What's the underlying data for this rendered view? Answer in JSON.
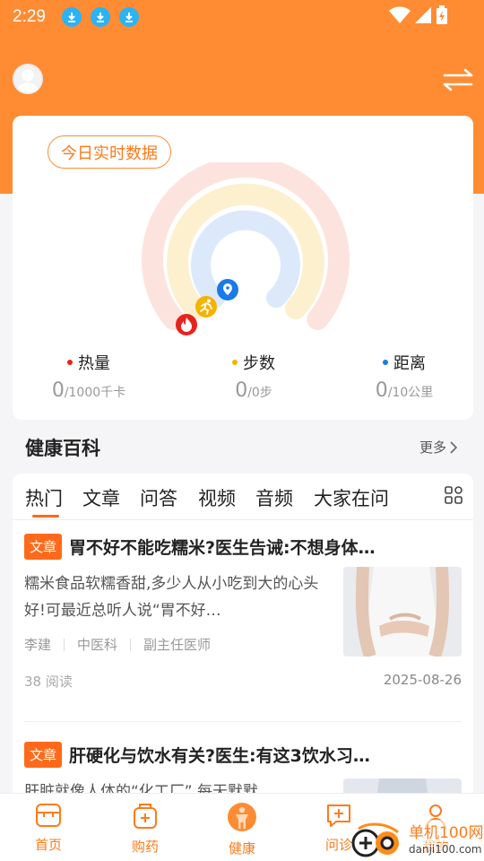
{
  "status": {
    "time": "2:29"
  },
  "card": {
    "pill_label": "今日实时数据",
    "metrics": [
      {
        "label": "热量",
        "value": "0",
        "unit": "/1000千卡",
        "color": "#e8231e"
      },
      {
        "label": "步数",
        "value": "0",
        "unit": "/0步",
        "color": "#f5b300"
      },
      {
        "label": "距离",
        "value": "0",
        "unit": "/10公里",
        "color": "#1a7ae8"
      }
    ]
  },
  "wiki": {
    "title": "健康百科",
    "more": "更多"
  },
  "tabs": [
    "热门",
    "文章",
    "问答",
    "视频",
    "音频",
    "大家在问"
  ],
  "articles": [
    {
      "tag": "文章",
      "title": "胃不好不能吃糯米?医生告诫:不想身体…",
      "desc": "糯米食品软糯香甜,多少人从小吃到大的心头好!可最近总听人说“胃不好…",
      "author": "李建",
      "dept": "中医科",
      "role": "副主任医师",
      "reads": "38 阅读",
      "date": "2025-08-26"
    },
    {
      "tag": "文章",
      "title": "肝硬化与饮水有关?医生:有这3饮水习…",
      "desc": "肝脏就像人体的“化工厂”,每天默默"
    }
  ],
  "nav": [
    {
      "label": "首页",
      "icon": "home-icon"
    },
    {
      "label": "购药",
      "icon": "medicine-icon"
    },
    {
      "label": "健康",
      "icon": "health-icon"
    },
    {
      "label": "问诊",
      "icon": "consult-icon"
    },
    {
      "label": "我的",
      "icon": "profile-icon"
    }
  ],
  "watermark": {
    "text_cn": "单机100网",
    "text_en": "danji100.com"
  },
  "colors": {
    "brand": "#ff8c33",
    "accent": "#ff6a1a"
  }
}
